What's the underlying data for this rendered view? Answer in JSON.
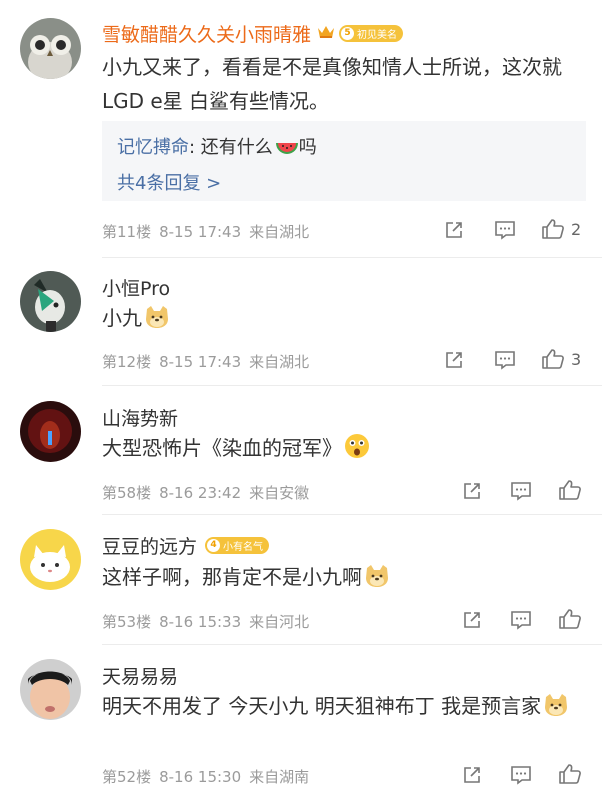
{
  "comments": [
    {
      "user": "雪敏醋醋久久关小雨晴雅",
      "fan_badge_level": "5",
      "fan_badge_text": "初见美名",
      "text": "小九又来了，看看是不是真像知情人士所说，这次就LGD e星 白鲨有些情况。",
      "reply": {
        "user": "记忆搏命",
        "text": ": 还有什么",
        "text_after_emoji": "吗",
        "more": "共4条回复 >"
      },
      "floor": "第11楼",
      "time": "8-15 17:43",
      "location": "来自湖北",
      "likes": "2"
    },
    {
      "user": "小恒Pro",
      "text": "小九",
      "floor": "第12楼",
      "time": "8-15 17:43",
      "location": "来自湖北",
      "likes": "3"
    },
    {
      "user": "山海势新",
      "text": "大型恐怖片《染血的冠军》",
      "floor": "第58楼",
      "time": "8-16 23:42",
      "location": "来自安徽",
      "likes": ""
    },
    {
      "user": "豆豆的远方",
      "fan_badge_level": "4",
      "fan_badge_text": "小有名气",
      "text": "这样子啊，那肯定不是小九啊",
      "floor": "第53楼",
      "time": "8-16 15:33",
      "location": "来自河北",
      "likes": ""
    },
    {
      "user": "天易易易",
      "text": "明天不用发了 今天小九 明天狙神布丁 我是预言家",
      "floor": "第52楼",
      "time": "8-16 15:30",
      "location": "来自湖南",
      "likes": ""
    }
  ],
  "colors": {
    "vip_name": "#ec6a19",
    "reply_user": "#4a6fa5",
    "meta": "#9b9b9b",
    "badge": "#f5c23b"
  },
  "icons": [
    "share-icon",
    "comment-icon",
    "like-icon",
    "doge-emoji",
    "watermelon-emoji",
    "shocked-emoji",
    "crown-icon"
  ]
}
